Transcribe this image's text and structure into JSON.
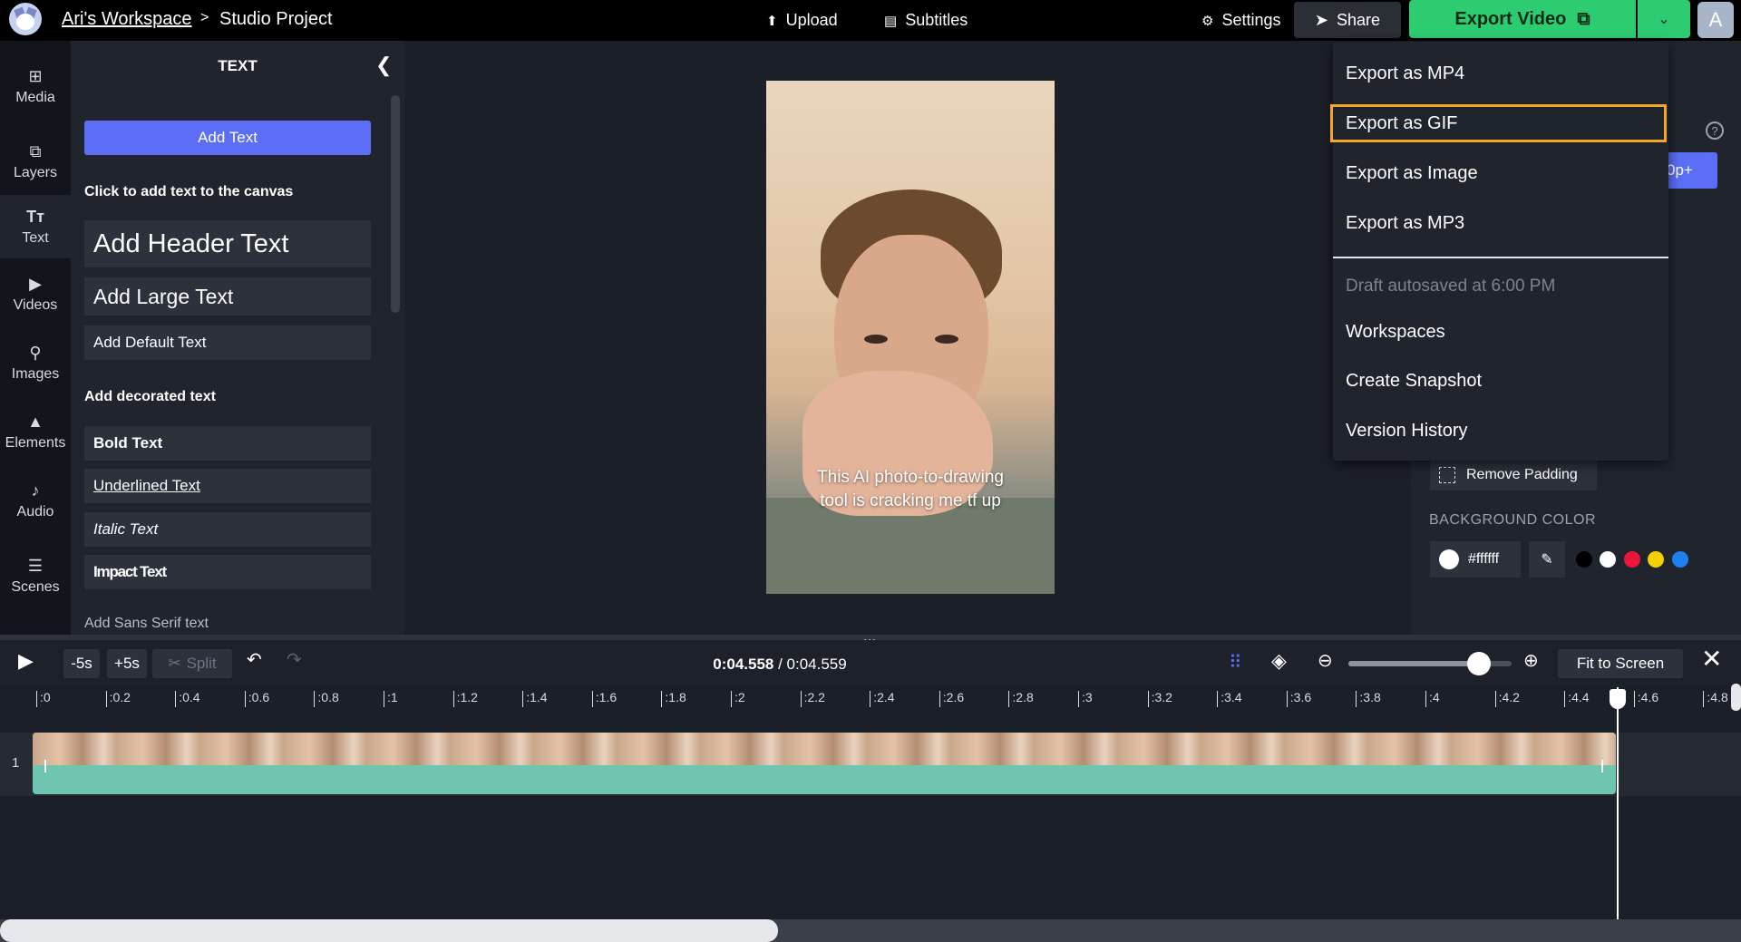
{
  "topbar": {
    "workspace": "Ari's Workspace",
    "separator": ">",
    "project": "Studio Project",
    "upload": "Upload",
    "subtitles": "Subtitles",
    "settings": "Settings",
    "share": "Share",
    "export": "Export Video",
    "avatar_initial": "A"
  },
  "leftrail": {
    "items": [
      {
        "label": "Media",
        "icon": "media-icon"
      },
      {
        "label": "Layers",
        "icon": "layers-icon"
      },
      {
        "label": "Text",
        "icon": "text-icon"
      },
      {
        "label": "Videos",
        "icon": "videos-icon"
      },
      {
        "label": "Images",
        "icon": "images-icon"
      },
      {
        "label": "Elements",
        "icon": "elements-icon"
      },
      {
        "label": "Audio",
        "icon": "audio-icon"
      },
      {
        "label": "Scenes",
        "icon": "scenes-icon"
      }
    ]
  },
  "textpanel": {
    "title": "TEXT",
    "add_text": "Add Text",
    "click_hint": "Click to add text to the canvas",
    "header_text": "Add Header Text",
    "large_text": "Add Large Text",
    "default_text": "Add Default Text",
    "decorated_label": "Add decorated text",
    "bold": "Bold Text",
    "underlined": "Underlined Text",
    "italic": "Italic Text",
    "impact": "Impact Text",
    "sans_label": "Add Sans Serif text"
  },
  "canvas": {
    "caption_line1": "This AI photo-to-drawing",
    "caption_line2": "tool is cracking me tf up"
  },
  "rightpanel": {
    "help": "?",
    "resolution_fragment": "0p+",
    "remove_padding": "Remove Padding",
    "bg_color_label": "BACKGROUND COLOR",
    "bg_color_value": "#ffffff",
    "swatches": [
      "#000000",
      "#ffffff",
      "#e8173a",
      "#f5d000",
      "#1e7ff0"
    ]
  },
  "menu": {
    "export_mp4": "Export as MP4",
    "export_gif": "Export as GIF",
    "export_image": "Export as Image",
    "export_mp3": "Export as MP3",
    "autosave": "Draft autosaved at 6:00 PM",
    "workspaces": "Workspaces",
    "snapshot": "Create Snapshot",
    "history": "Version History",
    "highlight_color": "#f6a623"
  },
  "timeline": {
    "minus5": "-5s",
    "plus5": "+5s",
    "split": "Split",
    "current_time": "0:04.558",
    "time_sep": " / ",
    "total_time": "0:04.559",
    "fit": "Fit to Screen",
    "zoom_level": 0.8,
    "track_number": "1",
    "ticks": [
      ":0",
      ":0.2",
      ":0.4",
      ":0.6",
      ":0.8",
      ":1",
      ":1.2",
      ":1.4",
      ":1.6",
      ":1.8",
      ":2",
      ":2.2",
      ":2.4",
      ":2.6",
      ":2.8",
      ":3",
      ":3.2",
      ":3.4",
      ":3.6",
      ":3.8",
      ":4",
      ":4.2",
      ":4.4",
      ":4.6",
      ":4.8"
    ]
  }
}
